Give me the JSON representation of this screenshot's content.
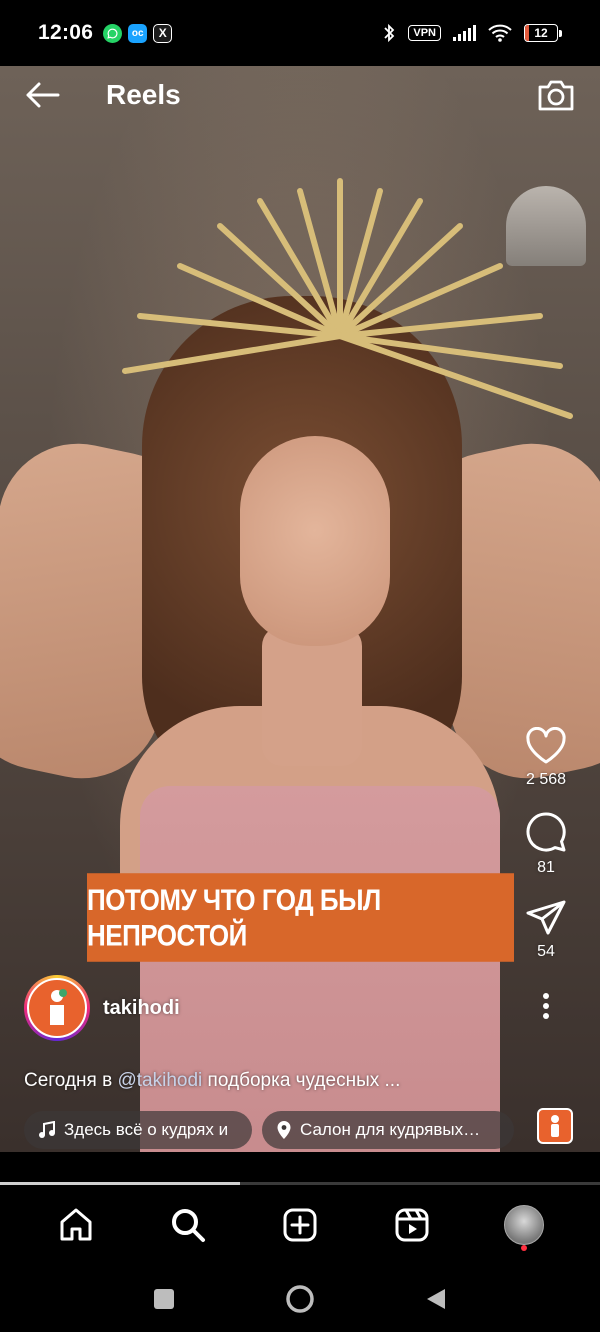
{
  "status_bar": {
    "time": "12:06",
    "apps": [
      "whatsapp-icon",
      "oc-app-icon",
      "x-app-icon"
    ],
    "vpn": "VPN",
    "battery": "12",
    "battery_level": 0.12
  },
  "header": {
    "title": "Reels"
  },
  "video": {
    "overlay_text": "ПОТОМУ ЧТО ГОД БЫЛ НЕПРОСТОЙ"
  },
  "actions": {
    "likes": "2 568",
    "comments": "81",
    "shares": "54"
  },
  "post": {
    "username": "takihodi",
    "description_prefix": "Сегодня в ",
    "description_mention": "@takihodi",
    "description_suffix": " подборка чудесных ...",
    "music_label": "Здесь всё о кудрях и",
    "location_label": "Салон для кудрявых…"
  },
  "progress": {
    "value": 0.4
  },
  "colors": {
    "overlay_bg": "#d8672a",
    "notification_dot": "#ff3040"
  }
}
